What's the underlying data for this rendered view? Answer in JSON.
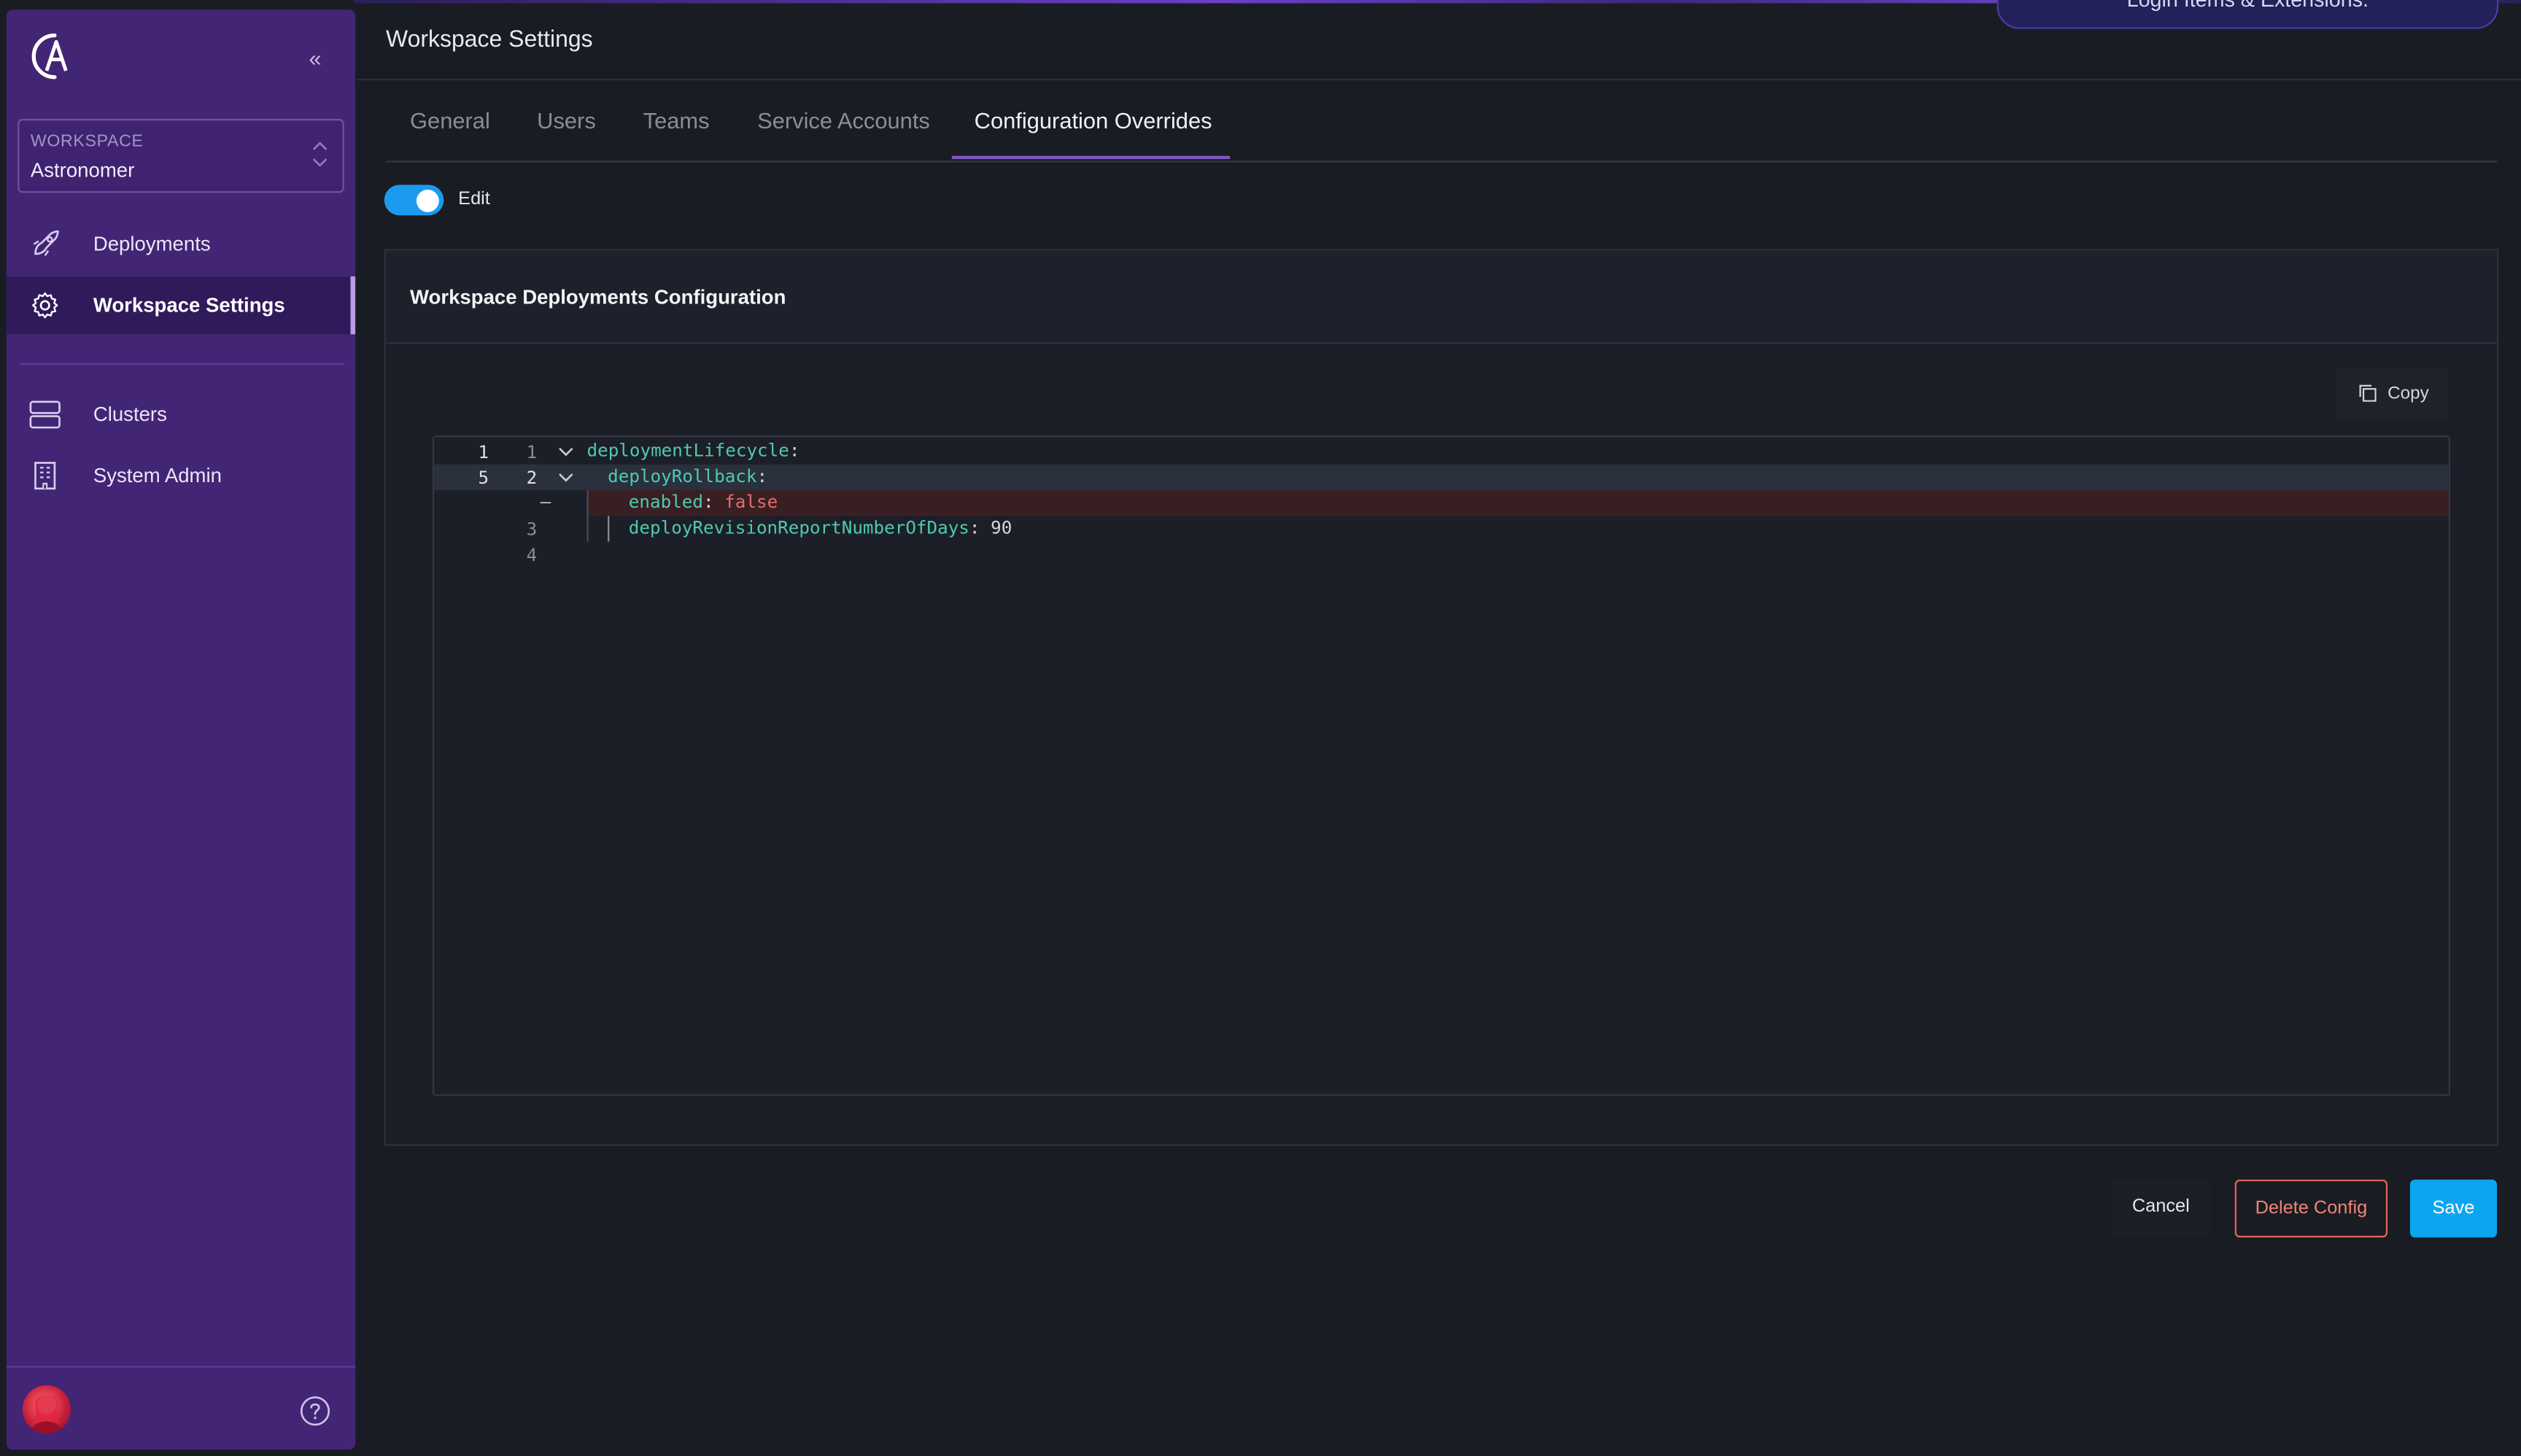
{
  "toast": {
    "text": "Login Items & Extensions."
  },
  "sidebar": {
    "workspace_label": "WORKSPACE",
    "workspace_value": "Astronomer",
    "items": [
      {
        "label": "Deployments",
        "icon": "rocket-icon",
        "active": false
      },
      {
        "label": "Workspace Settings",
        "icon": "gear-icon",
        "active": true
      },
      {
        "label": "Clusters",
        "icon": "server-icon",
        "active": false
      },
      {
        "label": "System Admin",
        "icon": "building-icon",
        "active": false
      }
    ]
  },
  "page": {
    "title": "Workspace Settings"
  },
  "tabs": [
    {
      "label": "General"
    },
    {
      "label": "Users"
    },
    {
      "label": "Teams"
    },
    {
      "label": "Service Accounts"
    },
    {
      "label": "Configuration Overrides"
    }
  ],
  "active_tab": "Configuration Overrides",
  "edit_toggle": {
    "label": "Edit",
    "on": true
  },
  "card": {
    "title": "Workspace Deployments Configuration"
  },
  "copy_button": {
    "label": "Copy"
  },
  "editor": {
    "lines": [
      {
        "orig": "1",
        "mod": "1",
        "key": "deploymentLifecycle",
        "punct": ":",
        "value": ""
      },
      {
        "orig": "5",
        "mod": "2",
        "key": "deployRollback",
        "punct": ":",
        "value": ""
      },
      {
        "orig": "",
        "mod": "",
        "marker": "–",
        "key": "enabled",
        "punct": ":",
        "value": "false"
      },
      {
        "orig": "",
        "mod": "3",
        "key": "deployRevisionReportNumberOfDays",
        "punct": ":",
        "value": "90"
      },
      {
        "orig": "",
        "mod": "4",
        "key": "",
        "punct": "",
        "value": ""
      }
    ]
  },
  "actions": {
    "cancel": "Cancel",
    "delete": "Delete Config",
    "save": "Save"
  },
  "colors": {
    "sidebar": "#432575",
    "accent_toggle": "#1a9bf0",
    "save": "#0ea5f0",
    "danger": "#e06a5a",
    "yaml_key": "#4fc9b3"
  }
}
